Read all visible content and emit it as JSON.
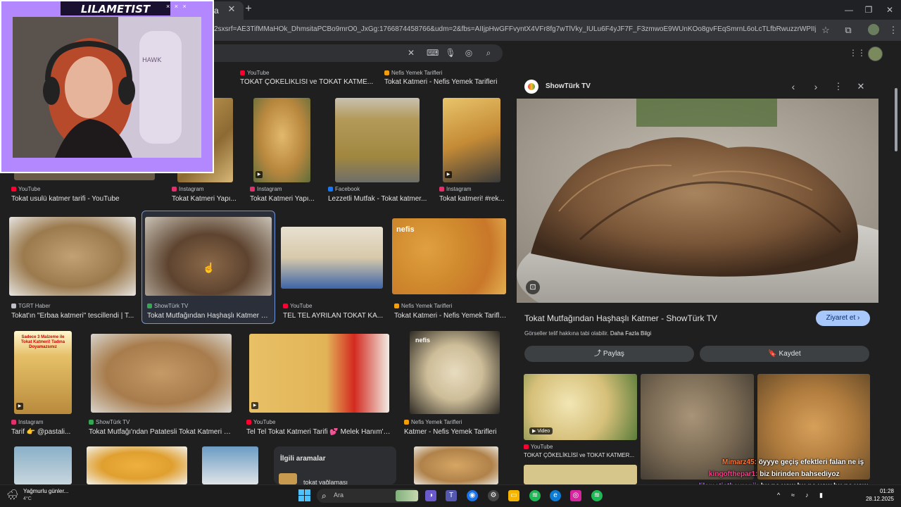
{
  "browser": {
    "tab_title": "ra",
    "url": "2sxsrf=AE3TifMMaHOk_DhmsitaPCBo9mrO0_JxGg:1766874458766&udm=2&fbs=AIIjpHwGFFvyntX4VFr8fg7wTlVky_IULu6F4yJF7F_F3zmwoE9WUnKOo8gvFEqSmrnL6oLcTLfbRwuzzrWPIIjOW8N7vHNoh7t8-f..."
  },
  "grid": {
    "row0": [
      {
        "source": "YouTube",
        "title": "TOKAT ÇÖKELİKLİSİ ve TOKAT KATME..."
      },
      {
        "source": "Nefis Yemek Tarifleri",
        "title": "Tokat Katmeri - Nefis Yemek Tarifleri"
      }
    ],
    "row1": [
      {
        "source": "YouTube",
        "title": "Tokat usulü katmer tarifi - YouTube"
      },
      {
        "source": "Instagram",
        "title": "Tokat Katmeri Yapı..."
      },
      {
        "source": "Instagram",
        "title": "Tokat Katmeri Yapı..."
      },
      {
        "source": "Facebook",
        "title": "Lezzetli Mutfak - Tokat katmer..."
      },
      {
        "source": "Instagram",
        "title": "Tokat katmeri! #rek..."
      }
    ],
    "row2": [
      {
        "source": "TGRT Haber",
        "title": "Tokat'ın \"Erbaa katmeri\" tescillendi | T..."
      },
      {
        "source": "ShowTürk TV",
        "title": "Tokat Mutfağından Haşhaşlı Katmer - ..."
      },
      {
        "source": "YouTube",
        "title": "TEL TEL AYRILAN TOKAT KA..."
      },
      {
        "source": "Nefis Yemek Tarifleri",
        "title": "Tokat Katmeri - Nefis Yemek Tarifleri"
      }
    ],
    "row3": [
      {
        "source": "Instagram",
        "title": "Tarif 👉 @pastali..."
      },
      {
        "source": "ShowTürk TV",
        "title": "Tokat Mutfağı'ndan Patatesli Tokat Katmeri - ..."
      },
      {
        "source": "YouTube",
        "title": "Tel Tel Tokat Katmeri Tarifi 💕 Melek Hanım'ı..."
      },
      {
        "source": "Nefis Yemek Tarifleri",
        "title": "Katmer - Nefis Yemek Tarifleri"
      }
    ],
    "thumb_overlay_text": "Sadece 3 Malzeme ile Tokat Katmeri! Tadına Doyamazsınız",
    "nefis_logo": "nefis",
    "related_searches": {
      "heading": "İlgili aramalar",
      "first_item": "tokat yağlaması"
    }
  },
  "sidepanel": {
    "site_name": "ShowTürk TV",
    "title": "Tokat Mutfağından Haşhaşlı Katmer - ShowTürk TV",
    "visit_label": "Ziyaret et",
    "copyright_prefix": "Görseller telif hakkına tabi olabilir.",
    "copyright_link": "Daha Fazla Bilgi",
    "share_label": "Paylaş",
    "save_label": "Kaydet",
    "related": [
      {
        "badge": "Video",
        "source": "YouTube",
        "title": "TOKAT ÇÖKELİKLİSİ ve TOKAT KATMER..."
      }
    ]
  },
  "overlay": {
    "streamer_name": "LILAMETIST",
    "chair_brand": "HAWK",
    "chat": [
      {
        "user": "Mimarz45:",
        "msg": "öyyye geçiş efektleri falan ne iş"
      },
      {
        "user": "kingofthepar1:",
        "msg": "biz birinden bahsediyoz"
      },
      {
        "user": "lilametisthayranii:",
        "msg": "bu ne yow bu ne yow bu ne yow"
      }
    ]
  },
  "taskbar": {
    "weather_title": "Yağmurlu günler...",
    "weather_temp": "4°C",
    "search_placeholder": "Ara",
    "time": "01:28",
    "date": "28.12.2025"
  },
  "colors": {
    "accent_blue": "#a8c7fa",
    "overlay_purple": "#b388ff",
    "youtube_red": "#ff0033",
    "instagram_pink": "#e1306c",
    "facebook_blue": "#1877f2"
  }
}
